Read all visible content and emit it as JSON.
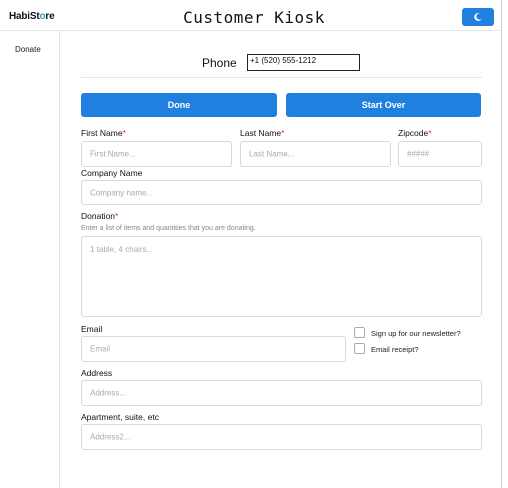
{
  "app": {
    "logo_prefix": "HabiSt",
    "logo_o": "o",
    "logo_suffix": "re",
    "title": "Customer Kiosk"
  },
  "sidebar": {
    "items": [
      {
        "label": "Donate"
      }
    ]
  },
  "phone": {
    "label": "Phone",
    "value": "+1 (520) 555-1212"
  },
  "actions": {
    "done_label": "Done",
    "start_over_label": "Start Over"
  },
  "form": {
    "first_name": {
      "label": "First Name",
      "required": "*",
      "placeholder": "First Name..."
    },
    "last_name": {
      "label": "Last Name",
      "required": "*",
      "placeholder": "Last Name..."
    },
    "zipcode": {
      "label": "Zipcode",
      "required": "*",
      "placeholder": "#####"
    },
    "company": {
      "label": "Company Name",
      "placeholder": "Company name..."
    },
    "donation": {
      "label": "Donation",
      "required": "*",
      "help": "Enter a list of items and quantities that you are donating.",
      "placeholder": "1 table, 4 chairs..."
    },
    "email": {
      "label": "Email",
      "placeholder": "Email"
    },
    "newsletter": {
      "label": "Sign up for our newsletter?",
      "checked": false
    },
    "email_receipt": {
      "label": "Email receipt?",
      "checked": false
    },
    "address": {
      "label": "Address",
      "placeholder": "Address..."
    },
    "address2": {
      "label": "Apartment, suite, etc",
      "placeholder": "Address2..."
    }
  },
  "colors": {
    "accent": "#1f80e0",
    "required": "#dd3333",
    "logo_o": "#2aa3c8"
  },
  "icons": {
    "theme_toggle": "moon-icon"
  }
}
